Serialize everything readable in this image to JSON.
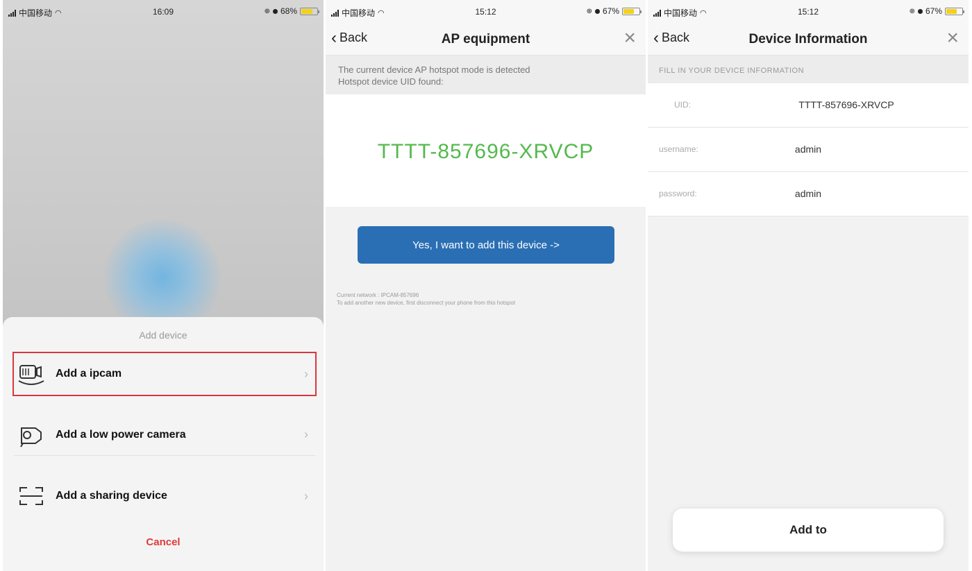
{
  "panel1": {
    "status": {
      "carrier": "中国移动",
      "time": "16:09",
      "battery": "68%"
    },
    "sheet_title": "Add device",
    "options": [
      {
        "label": "Add a ipcam",
        "icon": "ipcam-icon",
        "highlighted": true
      },
      {
        "label": "Add a low power camera",
        "icon": "low-power-camera-icon",
        "highlighted": false
      },
      {
        "label": "Add a sharing device",
        "icon": "scan-frame-icon",
        "highlighted": false
      }
    ],
    "cancel_label": "Cancel"
  },
  "panel2": {
    "status": {
      "carrier": "中国移动",
      "time": "15:12",
      "battery": "67%"
    },
    "back_label": "Back",
    "title": "AP equipment",
    "notice_line1": "The current device AP hotspot mode is detected",
    "notice_line2": "Hotspot device UID found:",
    "uid": "TTTT-857696-XRVCP",
    "add_button": "Yes, I want to add this device ->",
    "footer_line1": "Current network : IPCAM-857696",
    "footer_line2": "To add another new device, first disconnect your phone from this hotspot"
  },
  "panel3": {
    "status": {
      "carrier": "中国移动",
      "time": "15:12",
      "battery": "67%"
    },
    "back_label": "Back",
    "title": "Device Information",
    "section_title": "FILL IN YOUR DEVICE INFORMATION",
    "fields": [
      {
        "label": "UID:",
        "value": "TTTT-857696-XRVCP"
      },
      {
        "label": "username:",
        "value": "admin"
      },
      {
        "label": "password:",
        "value": "admin"
      }
    ],
    "submit_label": "Add to"
  },
  "colors": {
    "accent_blue": "#2a6fb4",
    "uid_green": "#54b94d",
    "cancel_red": "#e03a3a",
    "highlight_red": "#d9363e",
    "battery_yellow": "#f2d21b"
  }
}
